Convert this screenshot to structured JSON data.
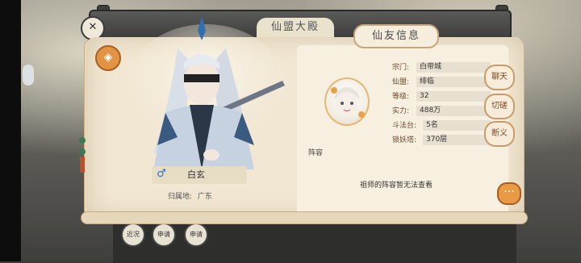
{
  "window": {
    "title": "仙盟大殿",
    "tab_label": "仙友信息"
  },
  "character": {
    "name": "白玄",
    "home_label": "归属地:",
    "home_value": "广东",
    "gender_icon": "male-icon"
  },
  "profile": {
    "lineup_label": "阵容",
    "lineup_note": "祖师的阵容暂无法查看",
    "fields": [
      {
        "label": "宗门:",
        "value": "白帝城"
      },
      {
        "label": "仙盟:",
        "value": "绯临"
      },
      {
        "label": "等级:",
        "value": "32"
      },
      {
        "label": "实力:",
        "value": "488万"
      },
      {
        "label": "斗法台:",
        "value": "5名"
      },
      {
        "label": "锁妖塔:",
        "value": "370层"
      }
    ]
  },
  "actions": {
    "chat": "聊天",
    "duel": "切磋",
    "adopt": "断义",
    "more": "···"
  },
  "bottom_tabs": [
    "近况",
    "申请",
    "申请"
  ],
  "colors": {
    "paper": "#f1e7d3",
    "accent_orange": "#e29445",
    "label_brown": "#6a4a2c"
  }
}
